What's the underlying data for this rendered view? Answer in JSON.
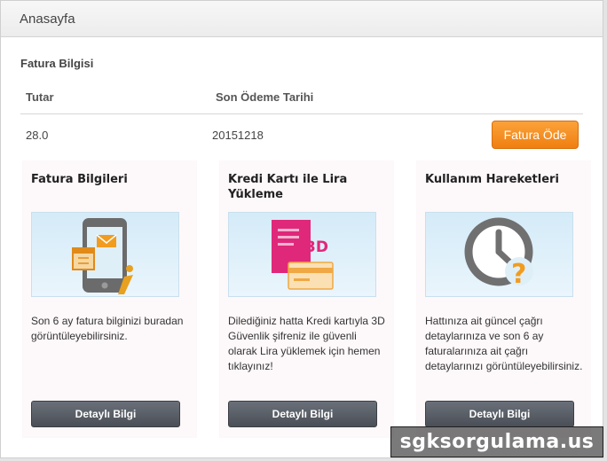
{
  "header": {
    "title": "Anasayfa"
  },
  "invoice": {
    "section_title": "Fatura Bilgisi",
    "columns": [
      "Tutar",
      "Son Ödeme Tarihi"
    ],
    "row": {
      "amount": "28.0",
      "due_date": "20151218"
    },
    "pay_label": "Fatura Öde"
  },
  "cards": [
    {
      "title": "Fatura Bilgileri",
      "icon": "phone-invoice-icon",
      "description": "Son 6 ay fatura bilginizi buradan görüntüleyebilirsiniz.",
      "button_label": "Detaylı Bilgi"
    },
    {
      "title": "Kredi Kartı ile Lira Yükleme",
      "icon": "credit-card-3d-icon",
      "description": "Dilediğiniz hatta Kredi kartıyla 3D Güvenlik şifreniz ile güvenli olarak Lira yüklemek için hemen tıklayınız!",
      "button_label": "Detaylı Bilgi"
    },
    {
      "title": "Kullanım Hareketleri",
      "icon": "clock-question-icon",
      "description": "Hattınıza ait güncel çağrı detaylarınıza ve son 6 ay faturalarınıza ait çağrı detaylarınızı görüntüleyebilirsiniz.",
      "button_label": "Detaylı Bilgi"
    }
  ],
  "colors": {
    "accent_orange": "#f28a1c",
    "button_dark": "#555a62",
    "icon_pink": "#e0287a",
    "icon_gray": "#707070"
  },
  "watermark": "sgksorgulama.us"
}
